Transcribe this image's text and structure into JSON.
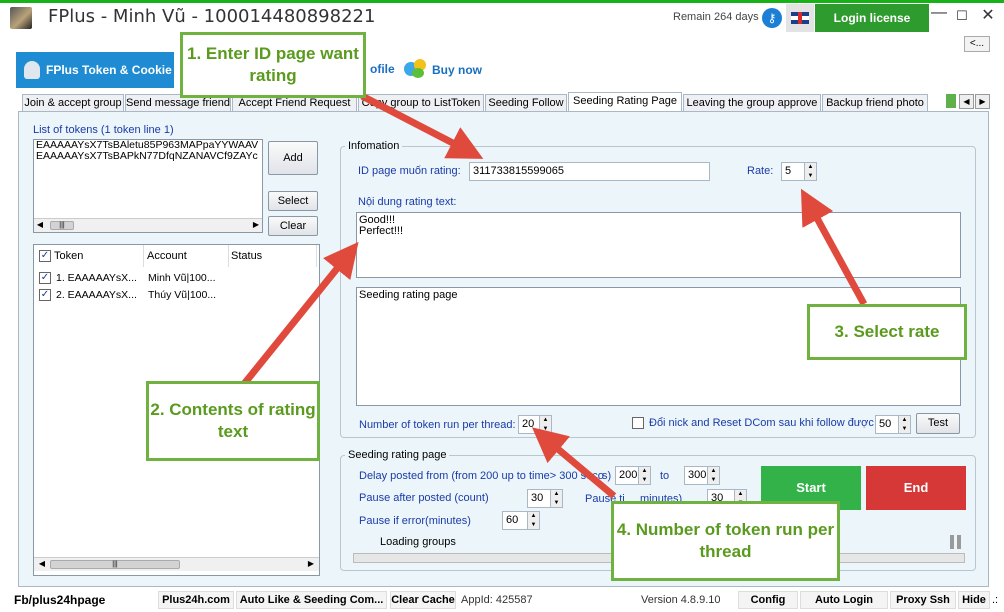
{
  "window": {
    "title": "FPlus - Minh Vũ - 100014480898221",
    "remain": "Remain 264 days",
    "login_license": "Login license",
    "min": "—",
    "max": "☐",
    "close": "✕"
  },
  "top": {
    "back": "<...",
    "fplus_tab": "FPlus Token & Cookie",
    "profile": "ofile",
    "buy_now": "Buy now"
  },
  "tabs": [
    {
      "label": "Join & accept group",
      "active": false
    },
    {
      "label": "Send message friend",
      "active": false
    },
    {
      "label": "Accept Friend Request",
      "active": false
    },
    {
      "label": "Copy group to ListToken",
      "active": false
    },
    {
      "label": "Seeding Follow",
      "active": false
    },
    {
      "label": "Seeding Rating Page",
      "active": true
    },
    {
      "label": "Leaving the group approve",
      "active": false
    },
    {
      "label": "Backup friend photo",
      "active": false
    }
  ],
  "tokens": {
    "label": "List of tokens (1 token line 1)",
    "lines": [
      "EAAAAAYsX7TsBAletu85P963MAPpaYYWAAV",
      "EAAAAAYsX7TsBAPkN77DfqNZANAVCf9ZAYc"
    ],
    "add": "Add",
    "select": "Select",
    "clear": "Clear"
  },
  "table": {
    "columns": [
      "Token",
      "Account",
      "Status"
    ],
    "rows": [
      {
        "token": "1. EAAAAAYsX...",
        "account": "Minh Vũ|100...",
        "status": ""
      },
      {
        "token": "2. EAAAAAYsX...",
        "account": "Thúy Vũ|100...",
        "status": ""
      }
    ]
  },
  "info": {
    "group_label": "Infomation",
    "id_page_label": "ID page muốn rating:",
    "id_page_value": "311733815599065",
    "rate_label": "Rate:",
    "rate_value": "5",
    "content_label": "Nội dung rating text:",
    "content_lines": [
      "Good!!!",
      "Perfect!!!"
    ],
    "log_text": "Seeding rating page",
    "threads_label": "Number of token run per thread:",
    "threads_value": "20",
    "reset_label": "Đổi nick and Reset DCom sau khi follow được",
    "reset_value": "50",
    "test": "Test"
  },
  "seeding": {
    "group_label": "Seeding rating page",
    "delay_label": "Delay posted from (from 200 up to time> 300 seco",
    "delay_tail": "s)",
    "delay_from": "200",
    "to_label": "to",
    "delay_to": "300",
    "pause_after_label": "Pause after posted (count)",
    "pause_after_value": "30",
    "pause_time_label": "Pause ti",
    "pause_time_tail": "minutes)",
    "pause_time_value": "30",
    "pause_error_label": "Pause if error(minutes)",
    "pause_error_value": "60",
    "loading": "Loading groups",
    "start": "Start",
    "end": "End"
  },
  "statusbar": {
    "fb": "Fb/plus24hpage",
    "site": "Plus24h.com",
    "auto_like": "Auto Like & Seeding Com...",
    "clear_cache": "Clear Cache",
    "appid": "AppId: 425587",
    "version": "Version 4.8.9.10",
    "config": "Config",
    "auto_login": "Auto Login",
    "proxy": "Proxy Ssh",
    "hide": "Hide",
    "grip": ".:"
  },
  "callouts": {
    "c1": "1. Enter ID page want rating",
    "c2": "2. Contents of rating text",
    "c3": "3. Select rate",
    "c4": "4. Number of token run per thread"
  },
  "colors": {
    "callout_border": "#6fb240",
    "arrow": "#e04a3c",
    "start": "#34b24a",
    "end": "#d63838",
    "tab_blue": "#1e8bd2"
  }
}
